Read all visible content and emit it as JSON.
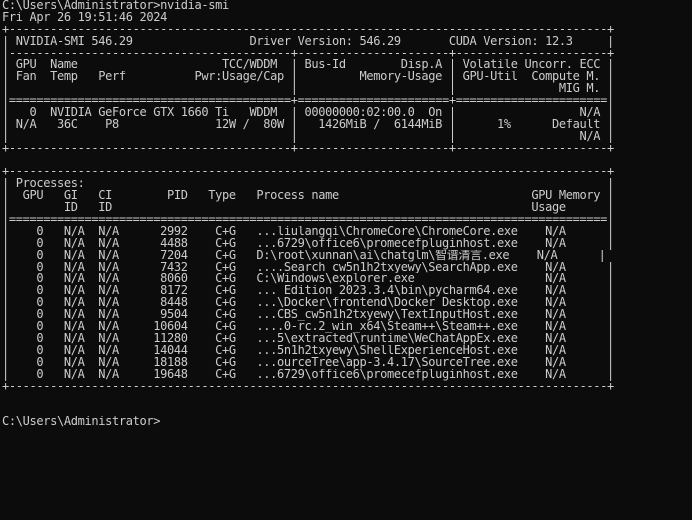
{
  "terminal": {
    "prompt_line": "C:\\Users\\Administrator>nvidia-smi",
    "timestamp": "Fri Apr 26 19:51:46 2024",
    "table_lines": [
      "+---------------------------------------------------------------------------------------+",
      "| NVIDIA-SMI 546.29                 Driver Version: 546.29       CUDA Version: 12.3     |",
      "|-----------------------------------------+----------------------+----------------------+",
      "| GPU  Name                     TCC/WDDM  | Bus-Id        Disp.A | Volatile Uncorr. ECC |",
      "| Fan  Temp   Perf          Pwr:Usage/Cap |         Memory-Usage | GPU-Util  Compute M. |",
      "|                                         |                      |               MIG M. |",
      "|=========================================+======================+======================|",
      "|   0  NVIDIA GeForce GTX 1660 Ti   WDDM  | 00000000:02:00.0  On |                  N/A |",
      "| N/A   36C    P8              12W /  80W |   1426MiB /  6144MiB |      1%      Default |",
      "|                                         |                      |                  N/A |",
      "+-----------------------------------------+----------------------+----------------------+",
      "",
      "+---------------------------------------------------------------------------------------+",
      "| Processes:                                                                            |",
      "|  GPU   GI   CI        PID   Type   Process name                            GPU Memory |",
      "|        ID   ID                                                             Usage      |",
      "|=======================================================================================|",
      "|    0   N/A  N/A      2992    C+G   ...liulangqi\\ChromeCore\\ChromeCore.exe    N/A      |",
      "|    0   N/A  N/A      4488    C+G   ...6729\\office6\\promecefpluginhost.exe    N/A      |",
      "|    0   N/A  N/A      7204    C+G   D:\\root\\xunnan\\ai\\chatglm\\智谱清言.exe    N/A      |",
      "|    0   N/A  N/A      7432    C+G   ....Search_cw5n1h2txyewy\\SearchApp.exe    N/A      |",
      "|    0   N/A  N/A      8060    C+G   C:\\Windows\\explorer.exe                   N/A      |",
      "|    0   N/A  N/A      8172    C+G   ... Edition 2023.3.4\\bin\\pycharm64.exe    N/A      |",
      "|    0   N/A  N/A      8448    C+G   ...\\Docker\\frontend\\Docker Desktop.exe    N/A      |",
      "|    0   N/A  N/A      9504    C+G   ...CBS_cw5n1h2txyewy\\TextInputHost.exe    N/A      |",
      "|    0   N/A  N/A     10604    C+G   ....0-rc.2_win_x64\\Steam++\\Steam++.exe    N/A      |",
      "|    0   N/A  N/A     11280    C+G   ...5\\extracted\\runtime\\WeChatAppEx.exe    N/A      |",
      "|    0   N/A  N/A     14044    C+G   ...5n1h2txyewy\\ShellExperienceHost.exe    N/A      |",
      "|    0   N/A  N/A     18188    C+G   ...ourceTree\\app-3.4.17\\SourceTree.exe    N/A      |",
      "|    0   N/A  N/A     19648    C+G   ...6729\\office6\\promecefpluginhost.exe    N/A      |",
      "+---------------------------------------------------------------------------------------+",
      "",
      "",
      "C:\\Users\\Administrator>"
    ]
  }
}
